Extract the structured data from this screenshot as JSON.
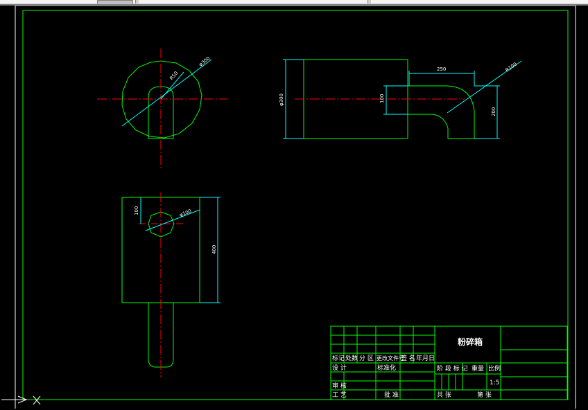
{
  "toolbar": {
    "segments": 3
  },
  "drawing": {
    "dimensions": {
      "top_diameter": "φ300",
      "top_radius": "R50",
      "side_left_diameter": "φ300",
      "side_length": "250",
      "side_radius": "R100",
      "side_inner": "100",
      "side_height": "200",
      "bottom_offset": "100",
      "bottom_hole": "φ100",
      "bottom_height": "400"
    },
    "title_block": {
      "title": "粉碎箱",
      "header_row": [
        "标记",
        "处数",
        "分 区",
        "更改文件号",
        "签 名",
        "年月日"
      ],
      "design_label": "设 计",
      "standard_label": "标准化",
      "review_label": "审 核",
      "process_label": "工 艺",
      "approve_label": "批 准",
      "stage_label": "阶 段 标 记",
      "weight_label": "重量",
      "scale_label": "比例",
      "scale_value": "1:5",
      "total_sheets": "共    张",
      "sheet_no": "第    张"
    },
    "ucs": {
      "axis_label": "X"
    }
  },
  "colors": {
    "outline": "#00ff00",
    "center": "#ff0000",
    "dimension": "#00ffff",
    "text": "#ffffff",
    "background": "#000000"
  }
}
